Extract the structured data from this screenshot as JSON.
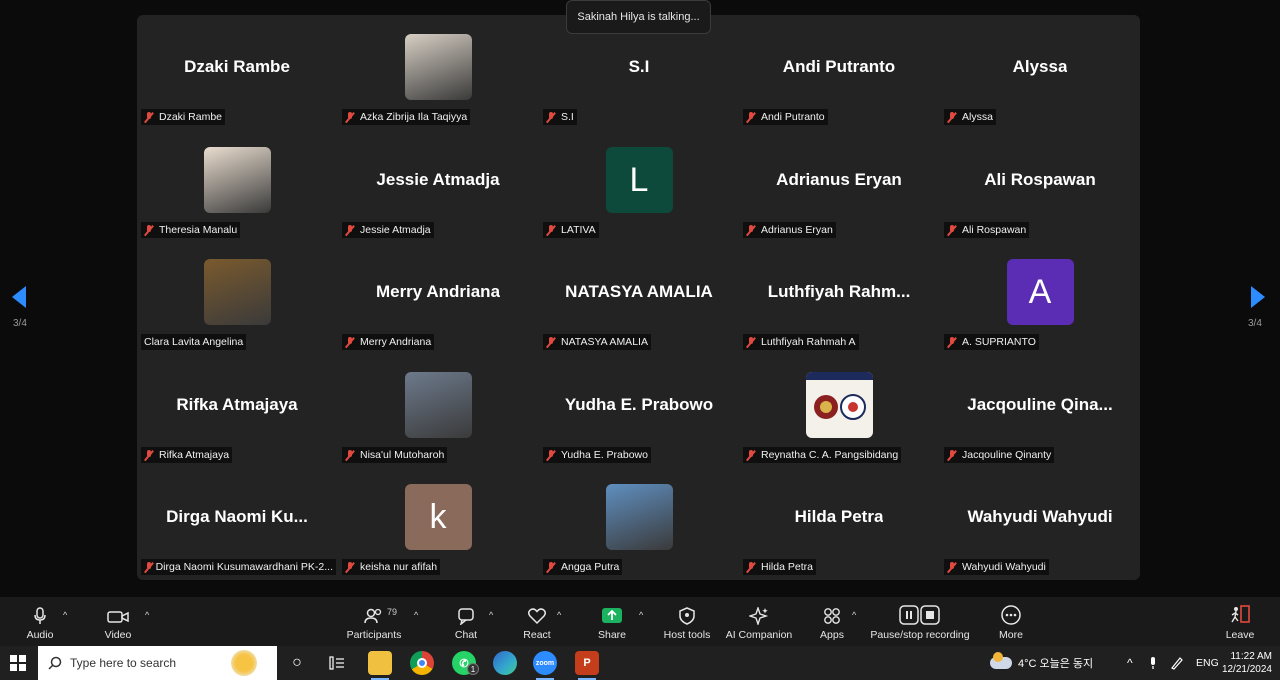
{
  "toast": "Sakinah Hilya is talking...",
  "page_indicator": "3/4",
  "tiles": [
    {
      "display": "Dzaki Rambe",
      "label": "Dzaki Rambe",
      "type": "name"
    },
    {
      "display": "",
      "label": "Azka Zibrija Ila Taqiyya",
      "type": "photo",
      "color": "#d7cfc4"
    },
    {
      "display": "S.I",
      "label": "S.I",
      "type": "name"
    },
    {
      "display": "Andi Putranto",
      "label": "Andi Putranto",
      "type": "name"
    },
    {
      "display": "Alyssa",
      "label": "Alyssa",
      "type": "name"
    },
    {
      "display": "",
      "label": "Theresia Manalu",
      "type": "photo",
      "color": "#e9ddcf"
    },
    {
      "display": "Jessie Atmadja",
      "label": "Jessie Atmadja",
      "type": "name"
    },
    {
      "display": "L",
      "label": "LATIVA",
      "type": "letter",
      "color": "#0d4a3c"
    },
    {
      "display": "Adrianus Eryan",
      "label": "Adrianus Eryan",
      "type": "name"
    },
    {
      "display": "Ali Rospawan",
      "label": "Ali Rospawan",
      "type": "name"
    },
    {
      "display": "",
      "label": "Clara Lavita Angelina",
      "type": "photo",
      "color": "#7a5a2e",
      "nomic": true
    },
    {
      "display": "Merry Andriana",
      "label": "Merry Andriana",
      "type": "name"
    },
    {
      "display": "NATASYA AMALIA",
      "label": "NATASYA AMALIA",
      "type": "name"
    },
    {
      "display": "Luthfiyah  Rahm...",
      "label": "Luthfiyah Rahmah A",
      "type": "name"
    },
    {
      "display": "A",
      "label": "A. SUPRIANTO",
      "type": "letter",
      "color": "#5b2db4"
    },
    {
      "display": "Rifka Atmajaya",
      "label": "Rifka Atmajaya",
      "type": "name"
    },
    {
      "display": "",
      "label": "Nisa'ul Mutoharoh",
      "type": "photo",
      "color": "#6d7a8c"
    },
    {
      "display": "Yudha E. Prabowo",
      "label": "Yudha E. Prabowo",
      "type": "name"
    },
    {
      "display": "",
      "label": "Reynatha C. A. Pangsibidang",
      "type": "logo",
      "color": "#f4f1ea"
    },
    {
      "display": "Jacqouline  Qina...",
      "label": "Jacqouline Qinanty",
      "type": "name"
    },
    {
      "display": "Dirga  Naomi  Ku...",
      "label": "Dirga Naomi Kusumawardhani PK-2...",
      "type": "name"
    },
    {
      "display": "k",
      "label": "keisha nur afifah",
      "type": "letter",
      "color": "#8a6a5a"
    },
    {
      "display": "",
      "label": "Angga Putra",
      "type": "photo",
      "color": "#5f8fc0"
    },
    {
      "display": "Hilda Petra",
      "label": "Hilda Petra",
      "type": "name"
    },
    {
      "display": "Wahyudi Wahyudi",
      "label": "Wahyudi Wahyudi",
      "type": "name"
    }
  ],
  "toolbar": {
    "audio": "Audio",
    "video": "Video",
    "participants": "Participants",
    "participants_count": "79",
    "chat": "Chat",
    "react": "React",
    "share": "Share",
    "host_tools": "Host tools",
    "ai_companion": "AI Companion",
    "apps": "Apps",
    "recording": "Pause/stop recording",
    "more": "More",
    "leave": "Leave"
  },
  "taskbar": {
    "search_placeholder": "Type here to search",
    "weather": "4°C  오늘은 동지",
    "lang": "ENG",
    "time": "11:22 AM",
    "date": "12/21/2024",
    "notif_count": "1",
    "zoom_label": "zoom"
  },
  "colors": {
    "accent": "#2d8cff",
    "mic_muted": "#e04a3f",
    "share_green": "#1bb35f"
  }
}
